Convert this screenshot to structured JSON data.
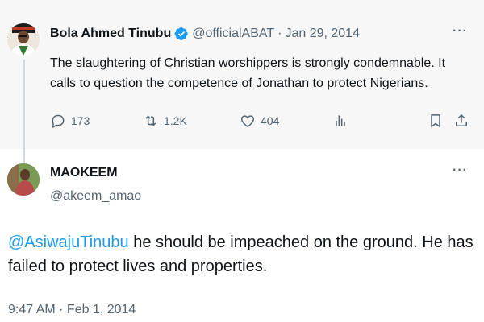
{
  "parent_tweet": {
    "author_name": "Bola Ahmed Tinubu",
    "handle": "@officialABAT",
    "separator": "·",
    "date": "Jan 29, 2014",
    "more": "···",
    "text": "The slaughtering of Christian worshippers  is strongly condemnable. It calls to question the competence of Jonathan to protect Nigerians.",
    "stats": {
      "replies": "173",
      "retweets": "1.2K",
      "likes": "404"
    },
    "icons": [
      "reply-icon",
      "retweet-icon",
      "like-icon",
      "views-icon",
      "bookmark-icon",
      "share-icon"
    ],
    "verified_color": "#1d9bf0"
  },
  "reply_tweet": {
    "author_name": "MAOKEEM",
    "handle": "@akeem_amao",
    "more": "···",
    "mention": "@AsiwajuTinubu",
    "text": " he should be impeached on the ground. He has failed to protect lives and properties.",
    "timestamp": "9:47 AM · Feb 1, 2014"
  },
  "colors": {
    "accent": "#1d9bf0",
    "secondary_text": "#536471",
    "primary_text": "#0f1419",
    "parent_bg": "#f7f7f7"
  }
}
